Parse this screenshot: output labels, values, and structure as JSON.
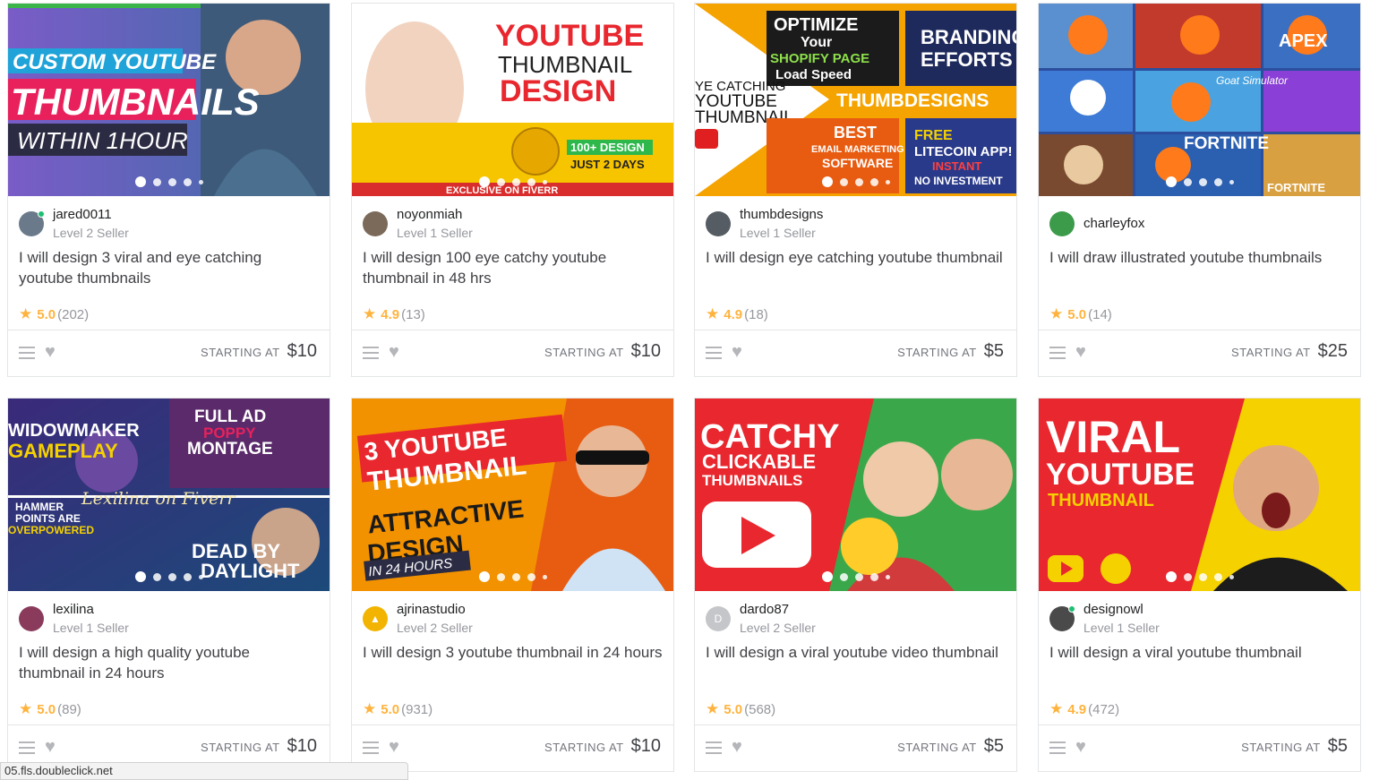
{
  "gigs": [
    {
      "thumb_texts": [
        "CUSTOM YOUTUBE",
        "THUMBNAILS",
        "WITHIN 1HOUR"
      ],
      "seller": "jared0011",
      "level": "Level 2 Seller",
      "title": "I will design 3 viral and eye catching youtube thumbnails",
      "rating": "5.0",
      "count": "(202)",
      "price_label": "STARTING AT",
      "price": "$10",
      "online": true,
      "avatar_color": "#6a7a8a"
    },
    {
      "thumb_texts": [
        "YOUTUBE",
        "THUMBNAIL",
        "DESIGN",
        "100+ DESIGN",
        "JUST 2 DAYS",
        "EXCLUSIVE ON FIVERR"
      ],
      "seller": "noyonmiah",
      "level": "Level 1 Seller",
      "title": "I will design 100 eye catchy youtube thumbnail in 48 hrs",
      "rating": "4.9",
      "count": "(13)",
      "price_label": "STARTING AT",
      "price": "$10",
      "online": false,
      "avatar_color": "#7b6a5a"
    },
    {
      "thumb_texts": [
        "OPTIMIZE",
        "Your",
        "SHOPIFY PAGE",
        "Load Speed",
        "BRANDING",
        "EFFORTS",
        "YE CATCHING",
        "YOUTUBE",
        "THUMBNAIL",
        "THUMBDESIGNS",
        "BEST",
        "EMAIL MARKETING",
        "SOFTWARE",
        "FREE",
        "LITECOIN APP!",
        "INSTANT",
        "NO INVESTMENT"
      ],
      "seller": "thumbdesigns",
      "level": "Level 1 Seller",
      "title": "I will design eye catching youtube thumbnail",
      "rating": "4.9",
      "count": "(18)",
      "price_label": "STARTING AT",
      "price": "$5",
      "online": false,
      "avatar_color": "#555c63"
    },
    {
      "thumb_texts": [
        "APEX",
        "Goat Simulator",
        "FORTNITE",
        "FORTNITE"
      ],
      "seller": "charleyfox",
      "level": "",
      "title": "I will draw illustrated youtube thumbnails",
      "rating": "5.0",
      "count": "(14)",
      "price_label": "STARTING AT",
      "price": "$25",
      "online": false,
      "avatar_color": "#3c9b4a"
    },
    {
      "thumb_texts": [
        "WIDOWMAKER",
        "GAMEPLAY",
        "FULL AD",
        "POPPY",
        "MONTAGE",
        "Lexilina on Fiverr",
        "HAMMER",
        "POINTS ARE",
        "OVERPOWERED",
        "DEAD BY",
        "DAYLIGHT"
      ],
      "seller": "lexilina",
      "level": "Level 1 Seller",
      "title": "I will design a high quality youtube thumbnail in 24 hours",
      "rating": "5.0",
      "count": "(89)",
      "price_label": "STARTING AT",
      "price": "$10",
      "online": false,
      "avatar_color": "#8a3b5c"
    },
    {
      "thumb_texts": [
        "3 YOUTUBE",
        "THUMBNAIL",
        "ATTRACTIVE",
        "DESIGN",
        "IN 24 HOURS"
      ],
      "seller": "ajrinastudio",
      "level": "Level 2 Seller",
      "title": "I will design 3 youtube thumbnail in 24 hours",
      "rating": "5.0",
      "count": "(931)",
      "price_label": "STARTING AT",
      "price": "$10",
      "online": false,
      "avatar_color": "#f2b400"
    },
    {
      "thumb_texts": [
        "CATCHY",
        "CLICKABLE",
        "THUMBNAILS"
      ],
      "seller": "dardo87",
      "level": "Level 2 Seller",
      "title": "I will design a viral youtube video thumbnail",
      "rating": "5.0",
      "count": "(568)",
      "price_label": "STARTING AT",
      "price": "$5",
      "online": false,
      "avatar_color": "#c5c6c9",
      "avatar_letter": "D"
    },
    {
      "thumb_texts": [
        "VIRAL",
        "YOUTUBE",
        "THUMBNAIL"
      ],
      "seller": "designowl",
      "level": "Level 1 Seller",
      "title": "I will design a viral youtube thumbnail",
      "rating": "4.9",
      "count": "(472)",
      "price_label": "STARTING AT",
      "price": "$5",
      "online": true,
      "avatar_color": "#4a4a4a"
    }
  ],
  "status_bar": "05.fls.doubleclick.net",
  "colors": {
    "star": "#ffb33e",
    "online": "#1dbf73"
  }
}
